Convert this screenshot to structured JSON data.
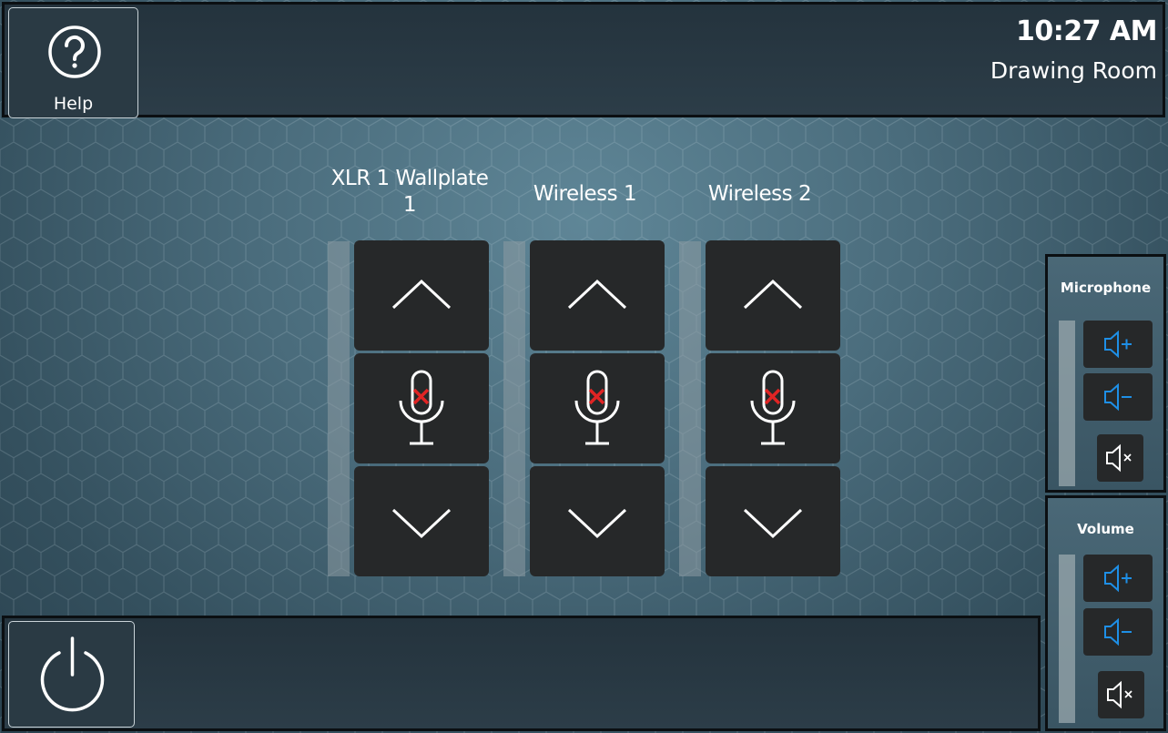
{
  "header": {
    "help_label": "Help",
    "time": "10:27 AM",
    "room": "Drawing Room"
  },
  "channels": [
    {
      "name": "XLR 1 Wallplate 1",
      "muted": true
    },
    {
      "name": "Wireless 1",
      "muted": true
    },
    {
      "name": "Wireless 2",
      "muted": true
    }
  ],
  "panels": {
    "microphone": {
      "title": "Microphone"
    },
    "volume": {
      "title": "Volume"
    }
  },
  "icons": {
    "help": "help-icon",
    "power": "power-icon",
    "up": "chevron-up-icon",
    "down": "chevron-down-icon",
    "mic_muted": "microphone-muted-icon",
    "vol_up": "volume-up-icon",
    "vol_down": "volume-down-icon",
    "mute": "volume-mute-icon"
  },
  "colors": {
    "accent": "#1e8fe6",
    "mute_x": "#e02424",
    "button_bg": "#262829"
  }
}
